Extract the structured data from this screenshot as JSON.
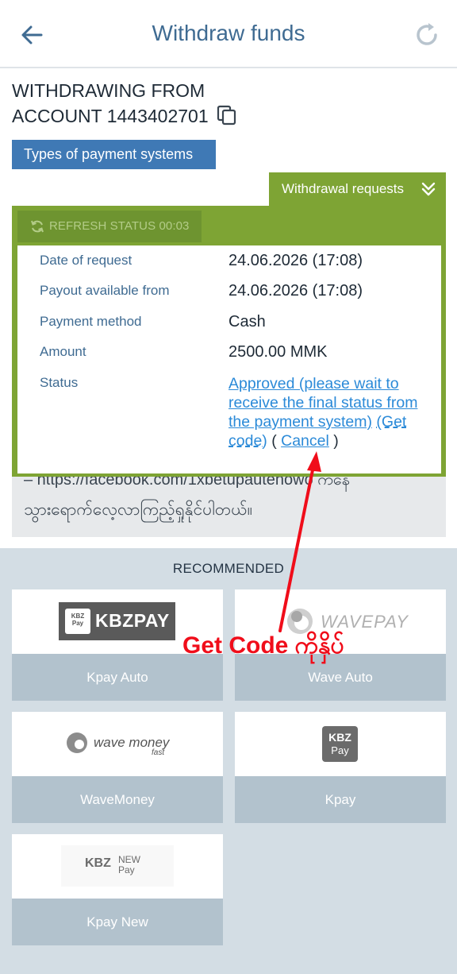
{
  "header": {
    "title": "Withdraw funds"
  },
  "account": {
    "line1": "WITHDRAWING FROM",
    "line2": "ACCOUNT 1443402701"
  },
  "types_button": "Types of payment systems",
  "withdrawal_tab": "Withdrawal requests",
  "refresh_status": "REFRESH STATUS 00:03",
  "details": {
    "rows": [
      {
        "label": "Date of request",
        "value": "24.06.2026 (17:08)"
      },
      {
        "label": "Payout available from",
        "value": "24.06.2026 (17:08)"
      },
      {
        "label": "Payment method",
        "value": "Cash"
      },
      {
        "label": "Amount",
        "value": "2500.00 MMK"
      }
    ],
    "status_label": "Status",
    "status_link": "Approved (please wait to receive the final status from the payment system)",
    "get_code": "(Get code)",
    "open_paren": "(",
    "cancel": "Cancel",
    "close_paren": ")"
  },
  "message": {
    "line1": "– https://facebook.com/1xbetupautehowo ကနေ",
    "line2": "သွားရောက်လေ့လာကြည့်ရှုနိုင်ပါတယ်။"
  },
  "recommended": {
    "title": "RECOMMENDED",
    "cards": [
      {
        "label": "Kpay Auto",
        "logo_text": "KBZPAY",
        "logo_small": "KBZ Pay"
      },
      {
        "label": "Wave Auto",
        "logo_text": "WAVEPAY"
      },
      {
        "label": "WaveMoney",
        "logo_text": "wave money",
        "logo_small": "fast"
      },
      {
        "label": "Kpay",
        "logo_text": "KBZ",
        "logo_small": "Pay"
      },
      {
        "label": "Kpay New",
        "logo_text": "KBZ",
        "logo_small": "NEW Pay"
      }
    ]
  },
  "annotation": {
    "text": "Get Code ကိုနှိပ်"
  },
  "colors": {
    "accent_blue": "#3f79b5",
    "green": "#7ea434",
    "link": "#2b8ad8",
    "annotation_red": "#f00d1a"
  }
}
